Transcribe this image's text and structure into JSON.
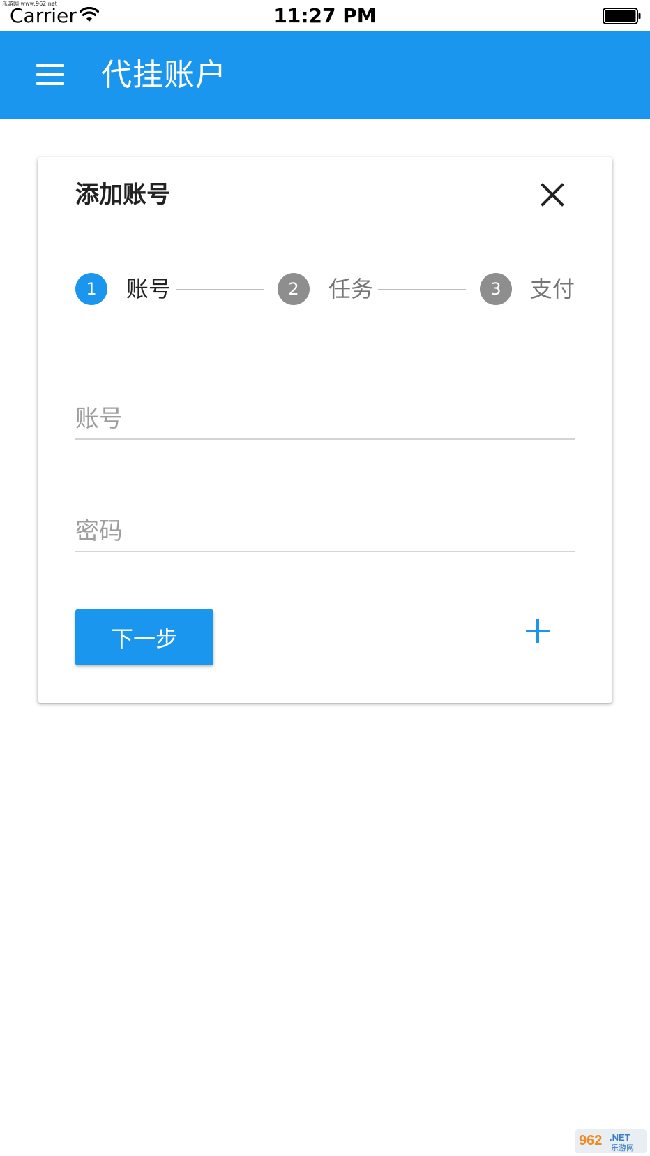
{
  "status_bar": {
    "watermark_text": "乐游网 www.962.net",
    "carrier": "Carrier",
    "time": "11:27 PM"
  },
  "app_bar": {
    "title": "代挂账户",
    "color": "#1b96ee"
  },
  "dialog": {
    "title": "添加账号",
    "steps": [
      {
        "number": "1",
        "label": "账号",
        "state": "active"
      },
      {
        "number": "2",
        "label": "任务",
        "state": "inactive"
      },
      {
        "number": "3",
        "label": "支付",
        "state": "inactive"
      }
    ],
    "fields": {
      "account": {
        "placeholder": "账号",
        "value": ""
      },
      "password": {
        "placeholder": "密码",
        "value": ""
      }
    },
    "next_button_label": "下一步"
  },
  "colors": {
    "accent": "#1b96ee",
    "step_inactive": "#8e8e8e",
    "text_primary": "#222222",
    "text_secondary": "#757575"
  },
  "icons": {
    "menu": "menu-icon",
    "close": "close-icon",
    "add": "add-icon",
    "wifi": "wifi-icon",
    "battery": "battery-icon"
  },
  "watermark_logo": "962.NET 乐游网"
}
